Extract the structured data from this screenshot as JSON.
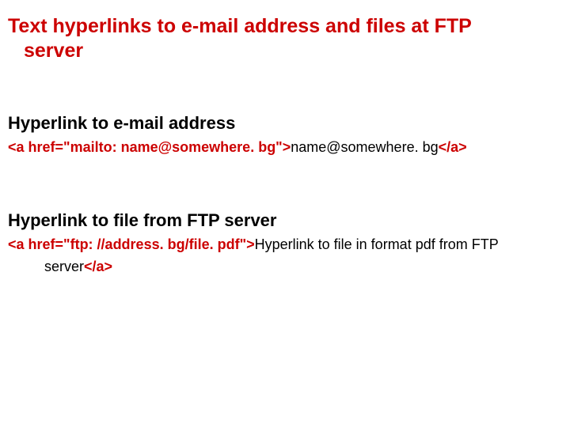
{
  "title_line1": "Text  hyperlinks to e-mail address and files at FTP",
  "title_line2": "server",
  "section1": {
    "heading": "Hyperlink to e-mail address",
    "code_prefix": "<a href=\"mailto: name@somewhere. bg\">",
    "code_text": "name@somewhere. bg",
    "code_suffix": "</a>"
  },
  "section2": {
    "heading": "Hyperlink to file from FTP server",
    "code_prefix": "<a href=\"ftp: //address. bg/file. pdf\">",
    "code_text_l1": "Hyperlink to file in format  pdf from FTP",
    "code_text_l2": "server",
    "code_suffix": "</a>"
  }
}
